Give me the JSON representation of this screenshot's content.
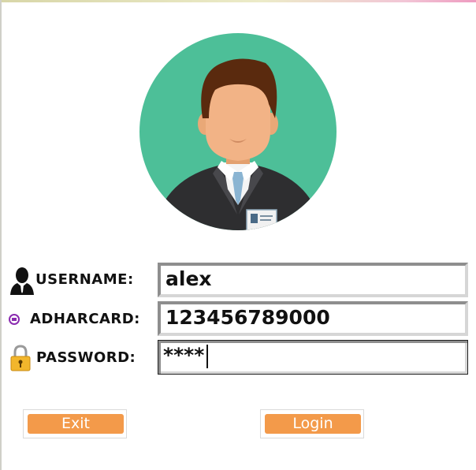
{
  "form": {
    "username": {
      "label": "USERNAME:",
      "value": "alex"
    },
    "adharcard": {
      "label": "ADHARCARD:",
      "value": "123456789000"
    },
    "password": {
      "label": "PASSWORD:",
      "value": "****"
    }
  },
  "buttons": {
    "exit_label": "Exit",
    "login_label": "Login"
  },
  "icons": {
    "avatar": "user-avatar-icon",
    "username": "user-silhouette-icon",
    "adharcard": "card-icon",
    "password": "padlock-icon"
  },
  "colors": {
    "button": "#f39a4a",
    "avatar_bg": "#4dbf98"
  }
}
